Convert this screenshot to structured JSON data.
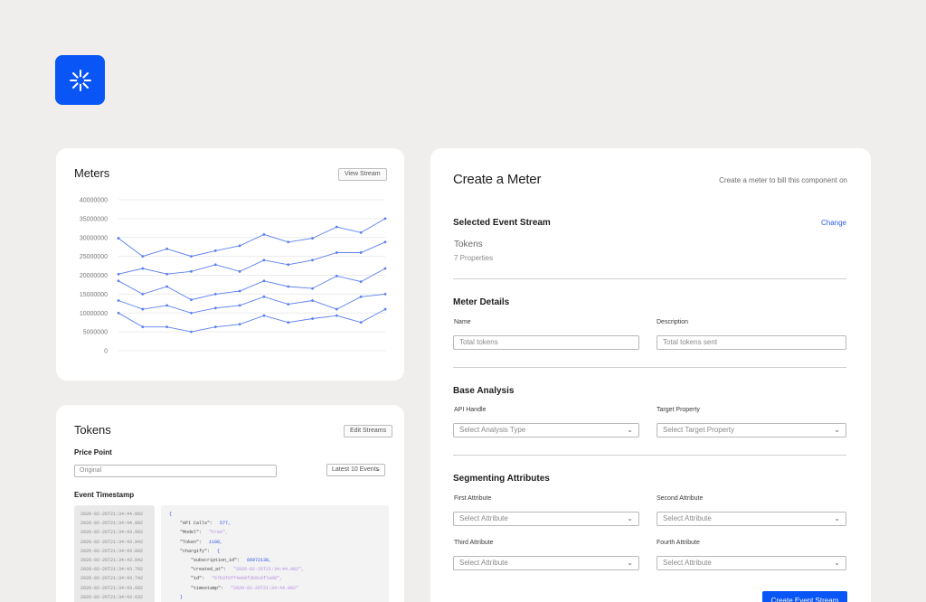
{
  "icons": {
    "logo": "asterisk-brand-icon",
    "chevron": "chevron-down-icon"
  },
  "colors": {
    "accent": "#0a55f5",
    "series_line": "#5b7ff0",
    "link": "#2f5bea"
  },
  "meters": {
    "title": "Meters",
    "view_stream_label": "View Stream"
  },
  "chart_data": {
    "type": "line",
    "title": "Meters",
    "x": [
      1,
      2,
      3,
      4,
      5,
      6,
      7,
      8,
      9,
      10,
      11,
      12
    ],
    "y_ticks": [
      "40000000",
      "35000000",
      "30000000",
      "25000000",
      "20000000",
      "15000000",
      "10000000",
      "5000000",
      "0"
    ],
    "ylim": [
      0,
      40000000
    ],
    "grid": true,
    "series": [
      {
        "values": [
          29800000,
          25000000,
          27000000,
          25000000,
          26500000,
          27800000,
          30800000,
          28800000,
          29800000,
          32800000,
          31300000,
          35000000
        ]
      },
      {
        "values": [
          20300000,
          21800000,
          20300000,
          21000000,
          22800000,
          21000000,
          24000000,
          22800000,
          24000000,
          26000000,
          26000000,
          28800000
        ]
      },
      {
        "values": [
          18500000,
          15000000,
          17000000,
          13500000,
          15000000,
          15800000,
          18500000,
          17000000,
          16500000,
          19800000,
          18300000,
          21800000
        ]
      },
      {
        "values": [
          13300000,
          11000000,
          12000000,
          10000000,
          11300000,
          12000000,
          14300000,
          12300000,
          13300000,
          11000000,
          14300000,
          15000000
        ]
      },
      {
        "values": [
          10000000,
          6300000,
          6300000,
          5000000,
          6300000,
          7000000,
          9300000,
          7500000,
          8500000,
          9300000,
          7500000,
          11000000
        ]
      }
    ]
  },
  "tokens": {
    "title": "Tokens",
    "edit_streams_label": "Edit Streams",
    "price_point_label": "Price Point",
    "price_point_value": "Original",
    "filter_value": "Latest 10 Events",
    "event_timestamp_label": "Event Timestamp",
    "timestamps": [
      "2026-02-26T21:34:44.092",
      "2026-02-26T21:34:44.092",
      "2026-02-26T21:34:43.992",
      "2026-02-26T21:34:43.942",
      "2026-02-26T21:34:43.892",
      "2026-02-26T21:34:43.842",
      "2026-02-26T21:34:43.792",
      "2026-02-26T21:34:43.742",
      "2026-02-26T21:34:43.692",
      "2026-02-26T21:34:43.632"
    ],
    "json_lines": [
      {
        "indent": 0,
        "text": "{",
        "cls": "cp"
      },
      {
        "indent": 1,
        "key": "\"API Calls\":",
        "value": "577,",
        "cls": "cn"
      },
      {
        "indent": 1,
        "key": "\"Model\":",
        "value": "\"Free\",",
        "cls": "cs"
      },
      {
        "indent": 1,
        "key": "\"Token\":",
        "value": "1108,",
        "cls": "cn"
      },
      {
        "indent": 1,
        "key": "\"chargify\":",
        "value": "{",
        "cls": "cp"
      },
      {
        "indent": 2,
        "key": "\"subscription_id\":",
        "value": "66972138,",
        "cls": "cn"
      },
      {
        "indent": 2,
        "key": "\"created_at\":",
        "value": "\"2026-02-26T21:34:44.082\",",
        "cls": "cs"
      },
      {
        "indent": 2,
        "key": "\"id\":",
        "value": "\"67b3f8ff4eb8f3b5c6f7a98\",",
        "cls": "cs"
      },
      {
        "indent": 2,
        "key": "\"timestamp\":",
        "value": "\"2026-02-26T21:34:44.092\"",
        "cls": "cs"
      },
      {
        "indent": 1,
        "text": "}",
        "cls": "cp"
      }
    ]
  },
  "create_meter": {
    "title": "Create a Meter",
    "subtitle": "Create a meter to bill  this component on",
    "selected_stream": {
      "title": "Selected Event Stream",
      "change_label": "Change",
      "stream_name": "Tokens",
      "properties": "7 Properties"
    },
    "meter_details": {
      "title": "Meter Details",
      "name_label": "Name",
      "name_placeholder": "Total tokens",
      "description_label": "Description",
      "description_placeholder": "Total tokens sent"
    },
    "base_analysis": {
      "title": "Base Analysis",
      "api_handle_label": "API Handle",
      "api_handle_value": "Select Analysis Type",
      "target_label": "Target Property",
      "target_value": "Select Target Property"
    },
    "segmenting": {
      "title": "Segmenting Attributes",
      "first_label": "First Attribute",
      "second_label": "Second Attribute",
      "third_label": "Third Attribute",
      "fourth_label": "Fourth Attribute",
      "select_value": "Select Attribute"
    },
    "submit_label": "Create Event Stream"
  }
}
